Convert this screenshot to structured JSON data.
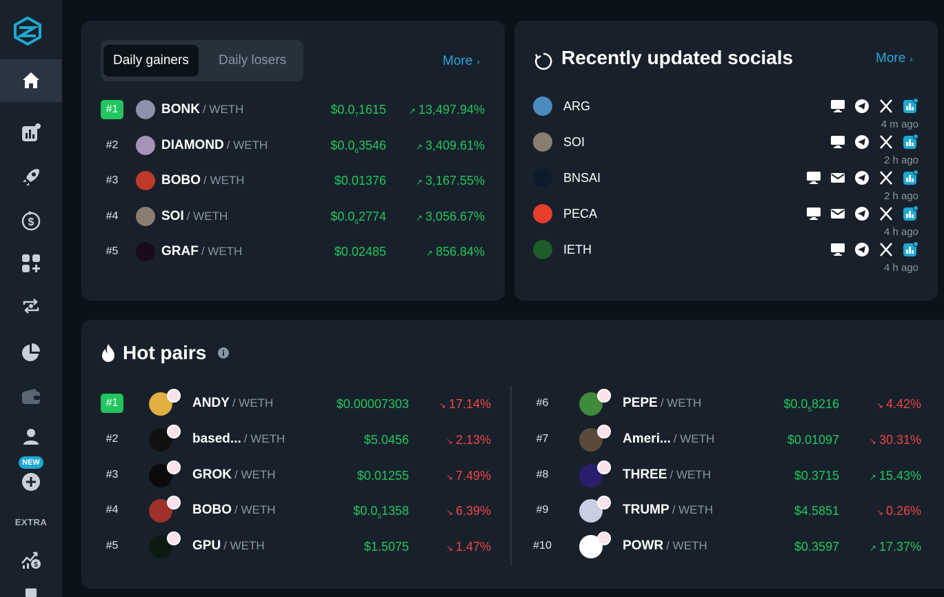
{
  "sidebar": {
    "items": [
      {
        "icon": "home-icon"
      },
      {
        "icon": "chart-bars-icon"
      },
      {
        "icon": "rocket-icon"
      },
      {
        "icon": "dollar-cycle-icon"
      },
      {
        "icon": "widgets-add-icon"
      },
      {
        "icon": "swap-icon"
      },
      {
        "icon": "pie-chart-icon"
      },
      {
        "icon": "wallet-icon"
      },
      {
        "icon": "user-icon"
      },
      {
        "icon": "add-circle-icon"
      },
      {
        "icon": "stats-dollar-icon"
      }
    ],
    "new_badge": "NEW",
    "extra_label": "EXTRA"
  },
  "gainers": {
    "tabs": [
      "Daily gainers",
      "Daily losers"
    ],
    "active_tab": "Daily gainers",
    "more_label": "More",
    "rows": [
      {
        "rank": "#1",
        "name": "BONK",
        "pair": "/ WETH",
        "price_pre": "$0.0",
        "price_sub": "7",
        "price_post": "1615",
        "change": "13,497.94%",
        "icon_color": "#8d93a8"
      },
      {
        "rank": "#2",
        "name": "DIAMOND",
        "pair": "/ WETH",
        "price_pre": "$0.0",
        "price_sub": "6",
        "price_post": "3546",
        "change": "3,409.61%",
        "icon_color": "#a893b8"
      },
      {
        "rank": "#3",
        "name": "BOBO",
        "pair": "/ WETH",
        "price_pre": "$0.01376",
        "price_sub": "",
        "price_post": "",
        "change": "3,167.55%",
        "icon_color": "#c0392b"
      },
      {
        "rank": "#4",
        "name": "SOI",
        "pair": "/ WETH",
        "price_pre": "$0.0",
        "price_sub": "6",
        "price_post": "2774",
        "change": "3,056.67%",
        "icon_color": "#8a7e70"
      },
      {
        "rank": "#5",
        "name": "GRAF",
        "pair": "/ WETH",
        "price_pre": "$0.02485",
        "price_sub": "",
        "price_post": "",
        "change": "856.84%",
        "icon_color": "#1a0b1c"
      }
    ]
  },
  "socials": {
    "title": "Recently updated socials",
    "more_label": "More",
    "rows": [
      {
        "name": "ARG",
        "ago": "4 m ago",
        "icons": [
          "desktop-icon",
          "telegram-icon",
          "x-icon",
          "chart-badge-icon"
        ],
        "icon_color": "#4a8cc0"
      },
      {
        "name": "SOI",
        "ago": "2 h ago",
        "icons": [
          "desktop-icon",
          "telegram-icon",
          "x-icon",
          "chart-badge-icon"
        ],
        "icon_color": "#8a7e70"
      },
      {
        "name": "BNSAI",
        "ago": "2 h ago",
        "icons": [
          "desktop-icon",
          "mail-icon",
          "telegram-icon",
          "x-icon",
          "chart-badge-icon"
        ],
        "icon_color": "#0e1b2a"
      },
      {
        "name": "PECA",
        "ago": "4 h ago",
        "icons": [
          "desktop-icon",
          "mail-icon",
          "telegram-icon",
          "x-icon",
          "chart-badge-icon"
        ],
        "icon_color": "#e53e2b"
      },
      {
        "name": "IETH",
        "ago": "4 h ago",
        "icons": [
          "desktop-icon",
          "telegram-icon",
          "x-icon",
          "chart-badge-icon"
        ],
        "icon_color": "#1e5c2a"
      }
    ]
  },
  "hot_pairs": {
    "title": "Hot pairs",
    "left": [
      {
        "rank": "#1",
        "name": "ANDY",
        "pair": "/ WETH",
        "price_pre": "$0.00007303",
        "price_sub": "",
        "price_post": "",
        "change": "17.14%",
        "dir": "down",
        "icon_color": "#e0b040"
      },
      {
        "rank": "#2",
        "name": "based...",
        "pair": "/ WETH",
        "price_pre": "$5.0456",
        "price_sub": "",
        "price_post": "",
        "change": "2.13%",
        "dir": "down",
        "icon_color": "#111"
      },
      {
        "rank": "#3",
        "name": "GROK",
        "pair": "/ WETH",
        "price_pre": "$0.01255",
        "price_sub": "",
        "price_post": "",
        "change": "7.49%",
        "dir": "down",
        "icon_color": "#0a0a0a"
      },
      {
        "rank": "#4",
        "name": "BOBO",
        "pair": "/ WETH",
        "price_pre": "$0.0",
        "price_sub": "5",
        "price_post": "1358",
        "change": "6.39%",
        "dir": "down",
        "icon_color": "#a0302a"
      },
      {
        "rank": "#5",
        "name": "GPU",
        "pair": "/ WETH",
        "price_pre": "$1.5075",
        "price_sub": "",
        "price_post": "",
        "change": "1.47%",
        "dir": "down",
        "icon_color": "#0d1a0f"
      }
    ],
    "right": [
      {
        "rank": "#6",
        "name": "PEPE",
        "pair": "/ WETH",
        "price_pre": "$0.0",
        "price_sub": "5",
        "price_post": "8216",
        "change": "4.42%",
        "dir": "down",
        "icon_color": "#3f8b3a"
      },
      {
        "rank": "#7",
        "name": "Ameri...",
        "pair": "/ WETH",
        "price_pre": "$0.01097",
        "price_sub": "",
        "price_post": "",
        "change": "30.31%",
        "dir": "down",
        "icon_color": "#5b4a3a"
      },
      {
        "rank": "#8",
        "name": "THREE",
        "pair": "/ WETH",
        "price_pre": "$0.3715",
        "price_sub": "",
        "price_post": "",
        "change": "15.43%",
        "dir": "up",
        "icon_color": "#2b1d6e"
      },
      {
        "rank": "#9",
        "name": "TRUMP",
        "pair": "/ WETH",
        "price_pre": "$4.5851",
        "price_sub": "",
        "price_post": "",
        "change": "0.26%",
        "dir": "down",
        "icon_color": "#c9cfe0"
      },
      {
        "rank": "#10",
        "name": "POWR",
        "pair": "/ WETH",
        "price_pre": "$0.3597",
        "price_sub": "",
        "price_post": "",
        "change": "17.37%",
        "dir": "up",
        "icon_color": "#ffffff"
      }
    ]
  },
  "colors": {
    "accent": "#2aa6d8",
    "positive": "#22c55e",
    "negative": "#ef4444",
    "panel": "#18212b",
    "background": "#0c1219"
  }
}
